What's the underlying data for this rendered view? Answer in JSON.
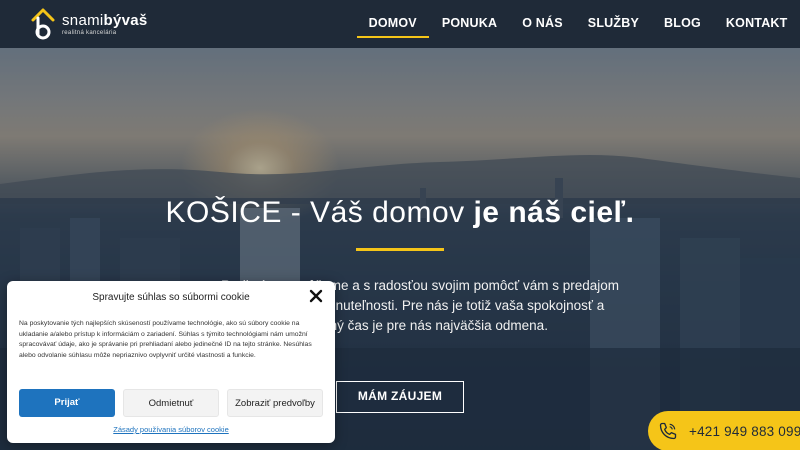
{
  "header": {
    "logo": {
      "name_light": "snami",
      "name_bold": "býva",
      "name_end": "š",
      "tagline": "realitná kancelária"
    },
    "nav": [
      {
        "label": "DOMOV",
        "active": true
      },
      {
        "label": "PONUKA",
        "active": false
      },
      {
        "label": "O NÁS",
        "active": false
      },
      {
        "label": "SLUŽBY",
        "active": false
      },
      {
        "label": "BLOG",
        "active": false
      },
      {
        "label": "KONTAKT",
        "active": false
      }
    ]
  },
  "hero": {
    "title_light": "KOŠICE - Váš domov ",
    "title_bold": "je náš cieľ.",
    "text": "Radi vám pomôžeme a s radosťou svojim pomôcť vám s predajom alebo kúpou nehnuteľnosti. Pre nás je totiž vaša spokojnosť a ušetrený čas je pre nás najväčšia odmena.",
    "cta_label": "MÁM ZÁUJEM"
  },
  "phone": {
    "number": "+421 949 883 099",
    "icon": "phone-icon"
  },
  "cookie": {
    "title": "Spravujte súhlas so súbormi cookie",
    "body": "Na poskytovanie tých najlepších skúseností používame technológie, ako sú súbory cookie na ukladanie a/alebo prístup k informáciám o zariadení. Súhlas s týmito technológiami nám umožní spracovávať údaje, ako je správanie pri prehliadaní alebo jedinečné ID na tejto stránke. Nesúhlas alebo odvolanie súhlasu môže nepriaznivo ovplyvniť určité vlastnosti a funkcie.",
    "accept_label": "Prijať",
    "deny_label": "Odmietnuť",
    "prefs_label": "Zobraziť predvoľby",
    "link_label": "Zásady používania súborov cookie"
  },
  "colors": {
    "accent": "#f5c518",
    "header_bg": "#1f2a38",
    "link": "#1e73be"
  }
}
